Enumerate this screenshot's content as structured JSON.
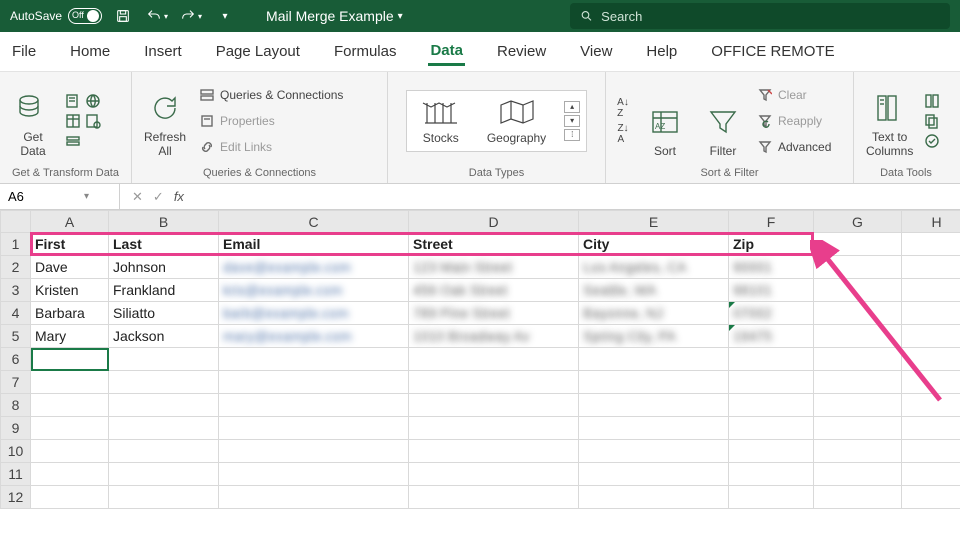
{
  "titlebar": {
    "autosave_label": "AutoSave",
    "autosave_state": "Off",
    "doc_title": "Mail Merge Example",
    "search_placeholder": "Search"
  },
  "menu": {
    "items": [
      "File",
      "Home",
      "Insert",
      "Page Layout",
      "Formulas",
      "Data",
      "Review",
      "View",
      "Help",
      "OFFICE REMOTE"
    ],
    "active": "Data"
  },
  "ribbon": {
    "get_data": "Get\nData",
    "group_get": "Get & Transform Data",
    "refresh_all": "Refresh\nAll",
    "queries_conn": "Queries & Connections",
    "properties": "Properties",
    "edit_links": "Edit Links",
    "group_queries": "Queries & Connections",
    "stocks": "Stocks",
    "geography": "Geography",
    "group_types": "Data Types",
    "sort": "Sort",
    "filter": "Filter",
    "clear": "Clear",
    "reapply": "Reapply",
    "advanced": "Advanced",
    "group_sort": "Sort & Filter",
    "text_cols": "Text to\nColumns",
    "group_tools": "Data Tools"
  },
  "formula_bar": {
    "name_box": "A6",
    "fx": "fx"
  },
  "grid": {
    "columns": [
      "A",
      "B",
      "C",
      "D",
      "E",
      "F",
      "G",
      "H"
    ],
    "header_row": [
      "First",
      "Last",
      "Email",
      "Street",
      "City",
      "Zip"
    ],
    "rows": [
      {
        "r": 2,
        "first": "Dave",
        "last": "Johnson",
        "email": "dave@example.com",
        "street": "123 Main Street",
        "city": "Los Angeles, CA",
        "zip": "90001"
      },
      {
        "r": 3,
        "first": "Kristen",
        "last": "Frankland",
        "email": "kris@example.com",
        "street": "456 Oak Street",
        "city": "Seattle, WA",
        "zip": "98101"
      },
      {
        "r": 4,
        "first": "Barbara",
        "last": "Siliatto",
        "email": "barb@example.com",
        "street": "789 Pine Street",
        "city": "Bayonne, NJ",
        "zip": "07002"
      },
      {
        "r": 5,
        "first": "Mary",
        "last": "Jackson",
        "email": "mary@example.com",
        "street": "1010 Broadway Av",
        "city": "Spring City, PA",
        "zip": "19475"
      }
    ],
    "selected_cell": "A6",
    "total_visible_rows": 12
  }
}
